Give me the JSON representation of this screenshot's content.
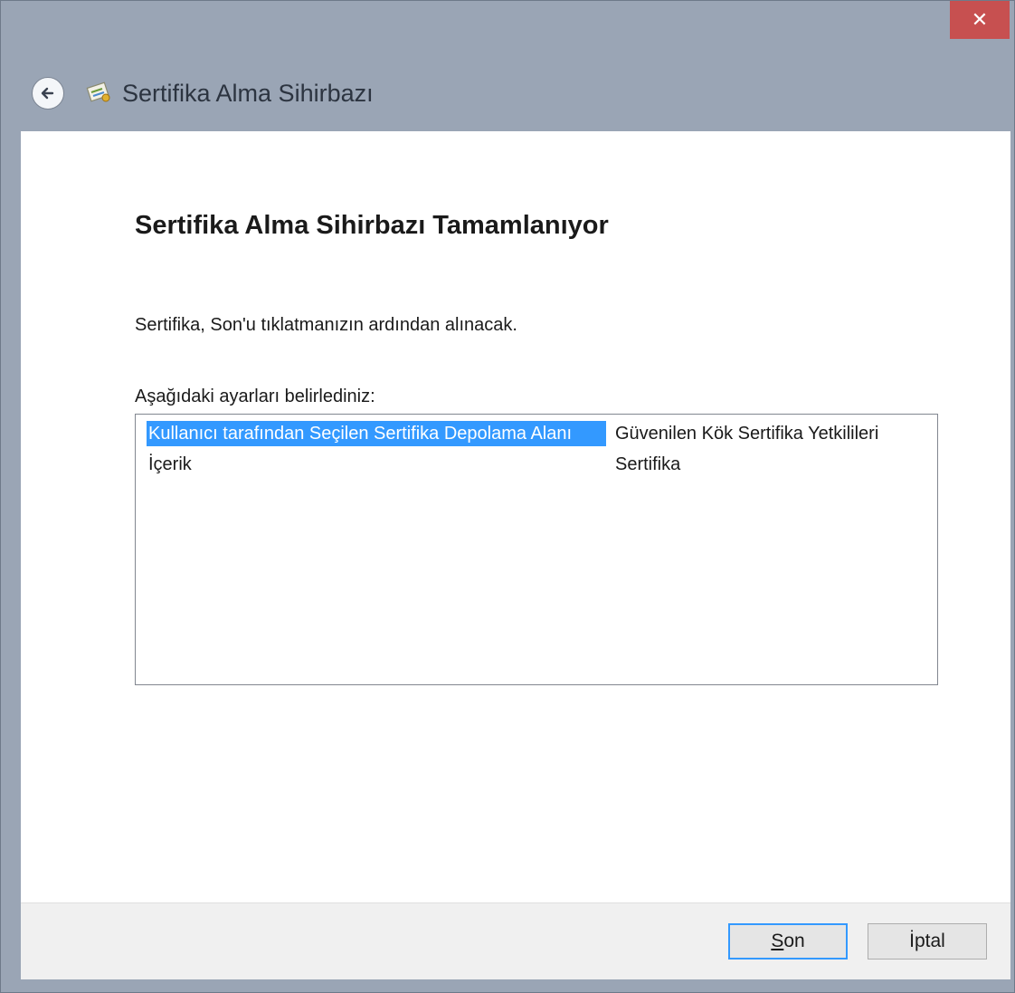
{
  "window": {
    "title": "Sertifika Alma Sihirbazı",
    "close_glyph": "✕",
    "accent": "#3399ff",
    "close_color": "#c75050"
  },
  "header": {
    "back_icon": "back-arrow-icon",
    "wizard_icon": "certificate-icon"
  },
  "main": {
    "heading": "Sertifika Alma Sihirbazı Tamamlanıyor",
    "info": "Sertifika, Son'u tıklatmanızın ardından alınacak.",
    "settings_label": "Aşağıdaki ayarları belirlediniz:",
    "settings": [
      {
        "key": "Kullanıcı tarafından Seçilen Sertifika Depolama Alanı",
        "value": "Güvenilen Kök Sertifika Yetkilileri",
        "selected": true
      },
      {
        "key": "İçerik",
        "value": "Sertifika",
        "selected": false
      }
    ]
  },
  "footer": {
    "finish_label": "Son",
    "cancel_label": "İptal"
  }
}
